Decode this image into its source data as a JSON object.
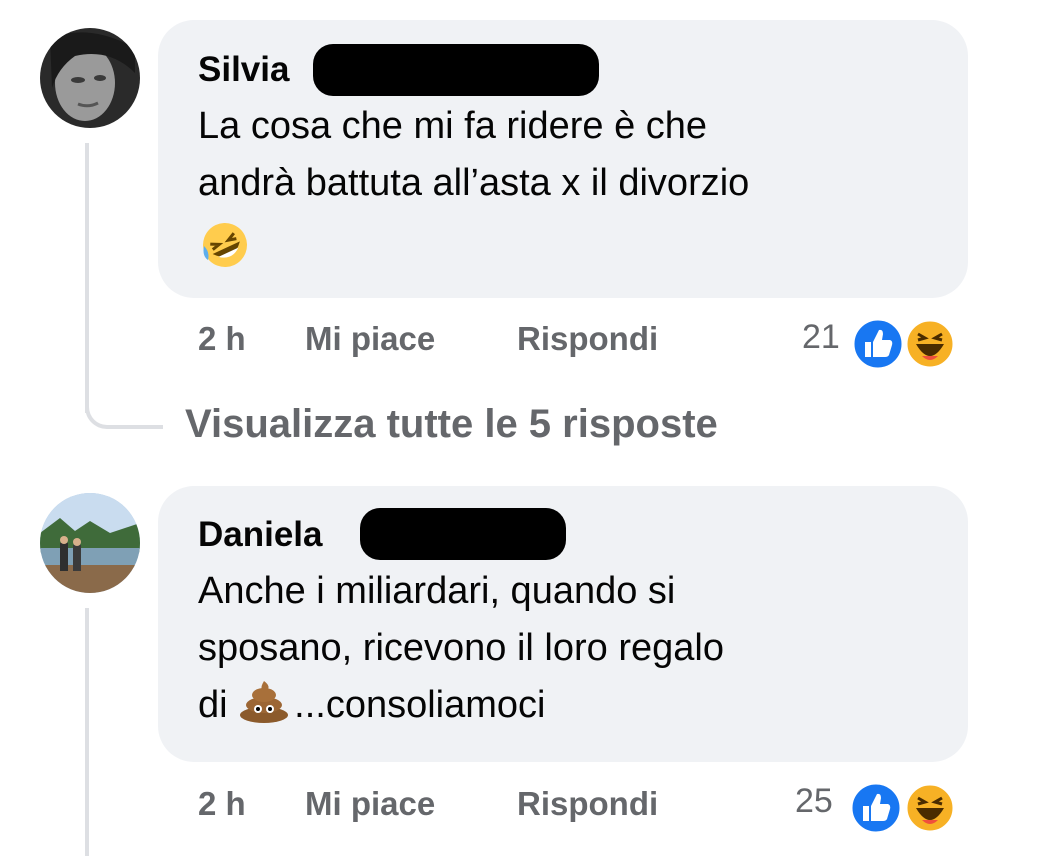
{
  "comments": [
    {
      "author": "Silvia",
      "lines": [
        "La cosa che mi fa ridere è che",
        "andrà battuta all’asta x il divorzio"
      ],
      "trailing_emoji": "rolling-on-floor-laughing",
      "time": "2 h",
      "like_label": "Mi piace",
      "reply_label": "Rispondi",
      "reaction_count": "21",
      "reactions": [
        "like",
        "haha"
      ]
    },
    {
      "author": "Daniela",
      "lines": [
        "Anche i miliardari, quando si",
        "sposano, ricevono il loro regalo",
        "...consoliamoci"
      ],
      "line3_prefix": "di ",
      "inline_emoji": "pile-of-poo",
      "time": "2 h",
      "like_label": "Mi piace",
      "reply_label": "Rispondi",
      "reaction_count": "25",
      "reactions": [
        "like",
        "haha"
      ]
    }
  ],
  "view_replies": "Visualizza tutte le 5 risposte",
  "colors": {
    "bubble": "#f0f2f5",
    "meta": "#65676b",
    "like_blue": "#1877f2",
    "haha_yellow": "#f7b125"
  }
}
